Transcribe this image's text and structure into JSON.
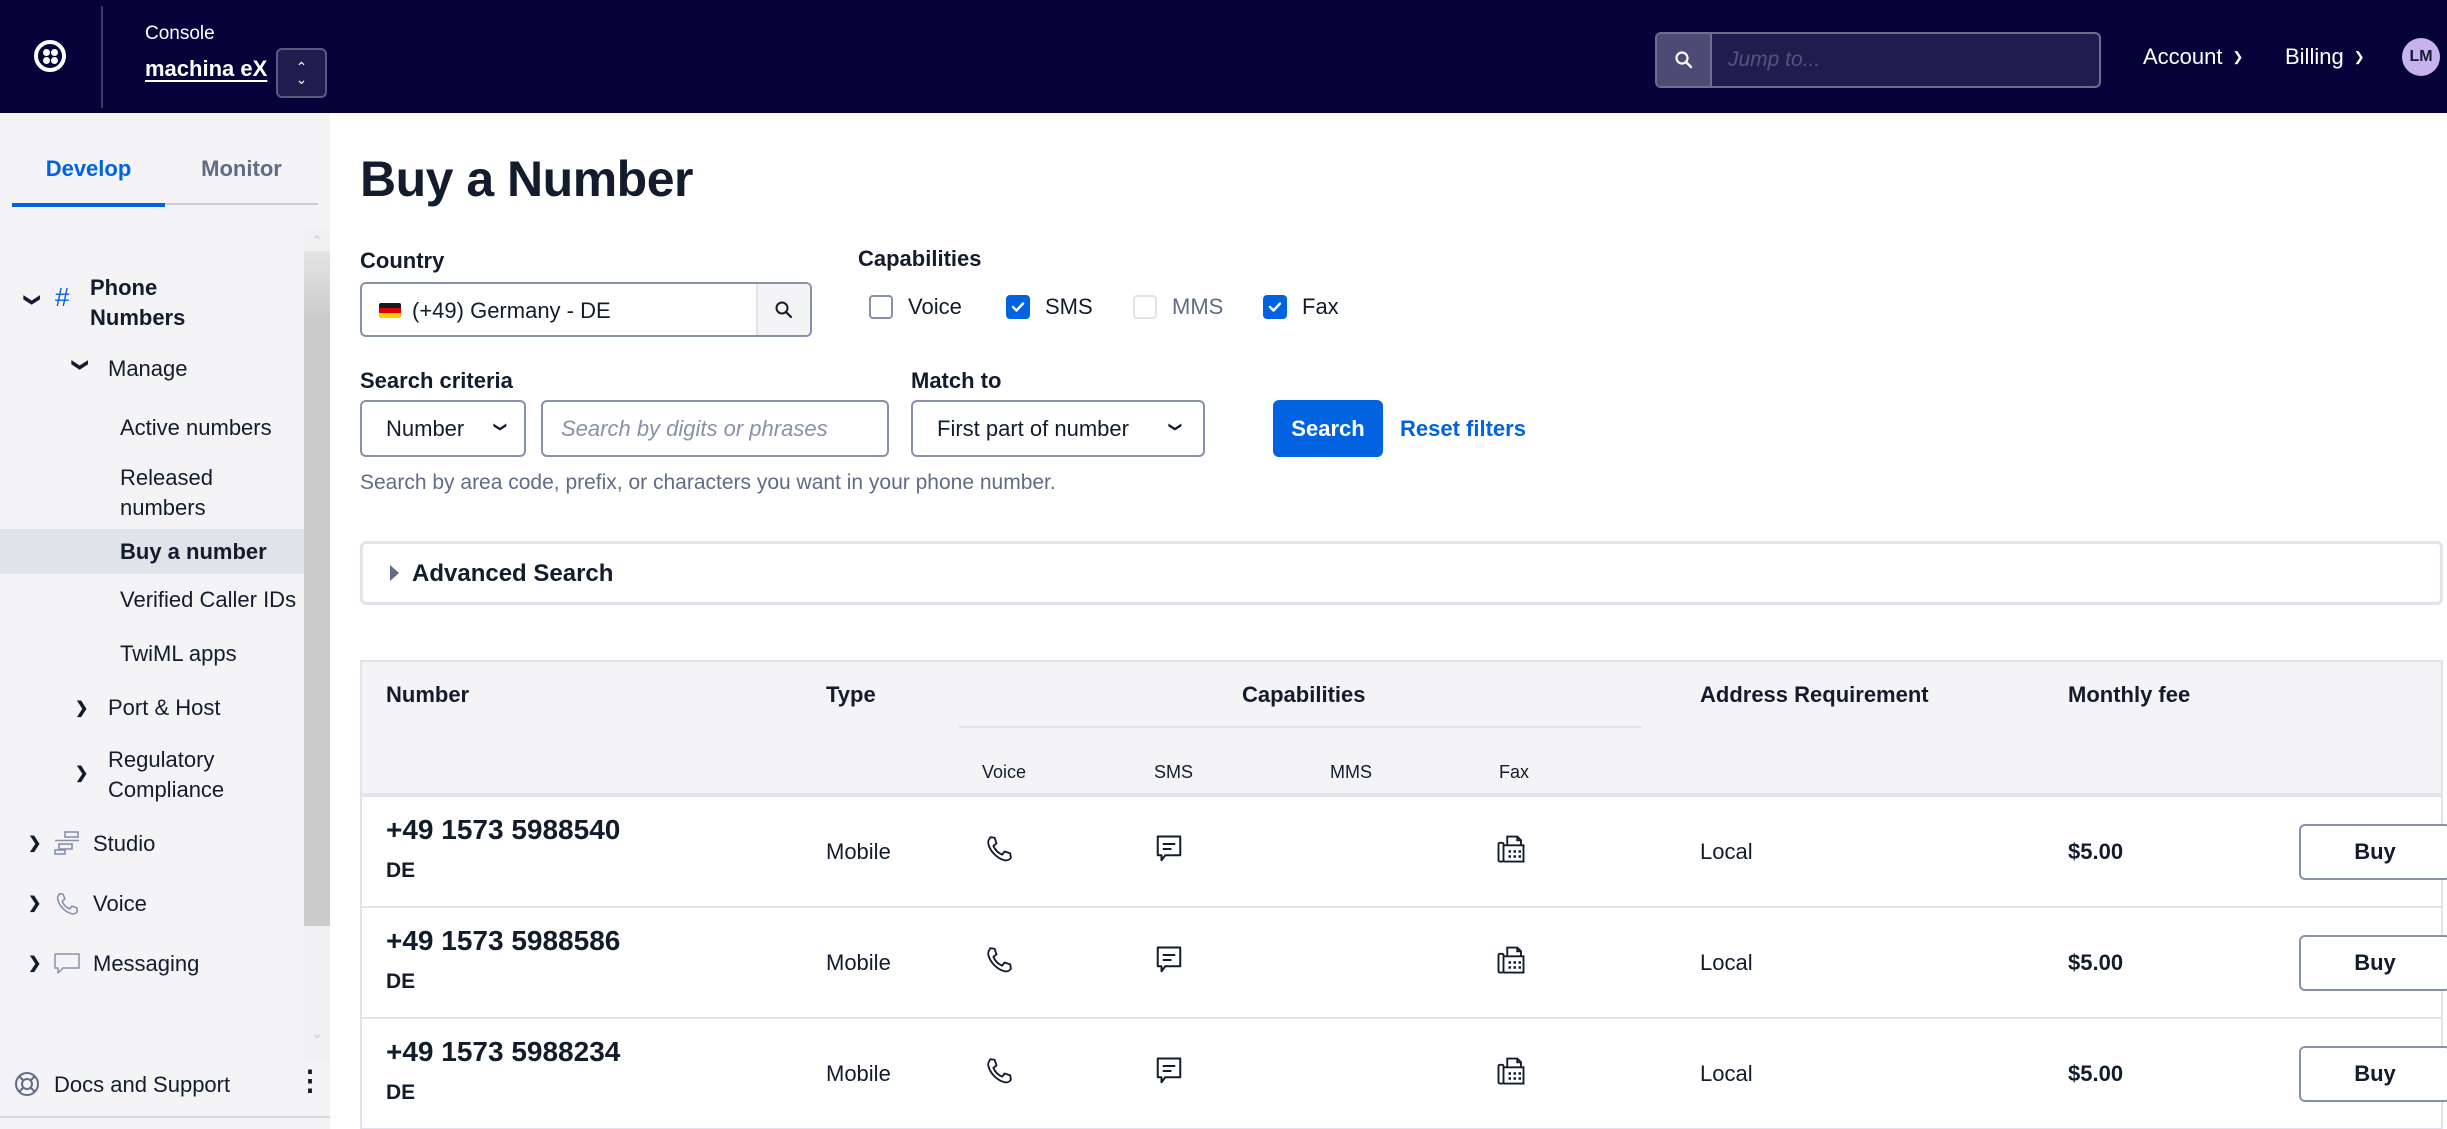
{
  "topbar": {
    "console_label": "Console",
    "account_name": "machina eX",
    "jump_placeholder": "Jump to...",
    "menus": [
      {
        "label": "Account"
      },
      {
        "label": "Billing"
      }
    ],
    "avatar_initials": "LM"
  },
  "sidebar": {
    "tabs": [
      {
        "label": "Develop",
        "active": true
      },
      {
        "label": "Monitor",
        "active": false
      }
    ],
    "phone_numbers": "Phone Numbers",
    "manage": "Manage",
    "manage_items": [
      {
        "label": "Active numbers"
      },
      {
        "label": "Released numbers"
      },
      {
        "label": "Buy a number",
        "selected": true
      },
      {
        "label": "Verified Caller IDs"
      },
      {
        "label": "TwiML apps"
      }
    ],
    "port_host": "Port & Host",
    "regulatory": "Regulatory Compliance",
    "products": [
      {
        "label": "Studio",
        "icon": "studio-icon"
      },
      {
        "label": "Voice",
        "icon": "phone-icon"
      },
      {
        "label": "Messaging",
        "icon": "message-icon"
      }
    ],
    "docs_support": "Docs and Support"
  },
  "main": {
    "title": "Buy a Number",
    "country": {
      "label": "Country",
      "value": "(+49) Germany - DE",
      "flag": "de"
    },
    "capabilities": {
      "label": "Capabilities",
      "options": [
        {
          "label": "Voice",
          "checked": false,
          "disabled": false
        },
        {
          "label": "SMS",
          "checked": true,
          "disabled": false
        },
        {
          "label": "MMS",
          "checked": false,
          "disabled": true
        },
        {
          "label": "Fax",
          "checked": true,
          "disabled": false
        }
      ]
    },
    "search_criteria": {
      "label": "Search criteria",
      "selected": "Number",
      "placeholder": "Search by digits or phrases"
    },
    "match_to": {
      "label": "Match to",
      "selected": "First part of number"
    },
    "search_button": "Search",
    "reset_link": "Reset filters",
    "help_text": "Search by area code, prefix, or characters you want in your phone number.",
    "advanced_search": "Advanced Search"
  },
  "table": {
    "headers": {
      "number": "Number",
      "type": "Type",
      "capabilities": "Capabilities",
      "voice": "Voice",
      "sms": "SMS",
      "mms": "MMS",
      "fax": "Fax",
      "address": "Address Requirement",
      "fee": "Monthly fee"
    },
    "rows": [
      {
        "number": "+49 1573 5988540",
        "country": "DE",
        "type": "Mobile",
        "voice": true,
        "sms": true,
        "mms": false,
        "fax": true,
        "address": "Local",
        "fee": "$5.00",
        "action": "Buy"
      },
      {
        "number": "+49 1573 5988586",
        "country": "DE",
        "type": "Mobile",
        "voice": true,
        "sms": true,
        "mms": false,
        "fax": true,
        "address": "Local",
        "fee": "$5.00",
        "action": "Buy"
      },
      {
        "number": "+49 1573 5988234",
        "country": "DE",
        "type": "Mobile",
        "voice": true,
        "sms": true,
        "mms": false,
        "fax": true,
        "address": "Local",
        "fee": "$5.00",
        "action": "Buy"
      }
    ]
  },
  "colors": {
    "topbar_bg": "#06033a",
    "accent": "#0263e0",
    "text": "#121c2d",
    "muted": "#606b85"
  }
}
